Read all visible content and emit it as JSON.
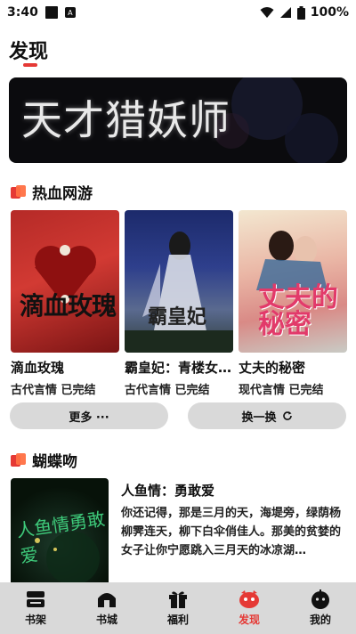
{
  "status": {
    "time": "3:40",
    "battery": "100%"
  },
  "page": {
    "title": "发现"
  },
  "banner": {
    "text": "天才猎妖师"
  },
  "sections": [
    {
      "title": "热血网游"
    },
    {
      "title": "蝴蝶吻"
    }
  ],
  "books": [
    {
      "name": "滴血玫瑰",
      "meta": "古代言情 已完结",
      "cover_text": "滴血玫瑰"
    },
    {
      "name": "霸皇妃：青楼女…",
      "meta": "古代言情 已完结",
      "cover_text": "霸皇妃"
    },
    {
      "name": "丈夫的秘密",
      "meta": "现代言情 已完结",
      "cover_text": "丈夫的秘密"
    }
  ],
  "buttons": {
    "more": "更多 ···",
    "swap": "换一换",
    "swap_icon": "refresh-icon"
  },
  "feature": {
    "title": "人鱼情：勇敢爱",
    "description": "你还记得，那是三月的天，海堤旁，绿荫杨柳霁连天，柳下白伞俏佳人。那美的贫婪的女子让你宁愿跳入三月天的冰凉湖…",
    "cover_text": "人鱼情勇敢爱"
  },
  "nav": [
    {
      "label": "书架",
      "icon": "bookshelf-icon"
    },
    {
      "label": "书城",
      "icon": "bookstore-icon"
    },
    {
      "label": "福利",
      "icon": "gift-icon"
    },
    {
      "label": "发现",
      "icon": "discover-icon",
      "active": true
    },
    {
      "label": "我的",
      "icon": "profile-icon"
    }
  ],
  "colors": {
    "accent": "#e53935",
    "nav_bg": "#d9d9d9",
    "button_bg": "#d9d9d9"
  }
}
